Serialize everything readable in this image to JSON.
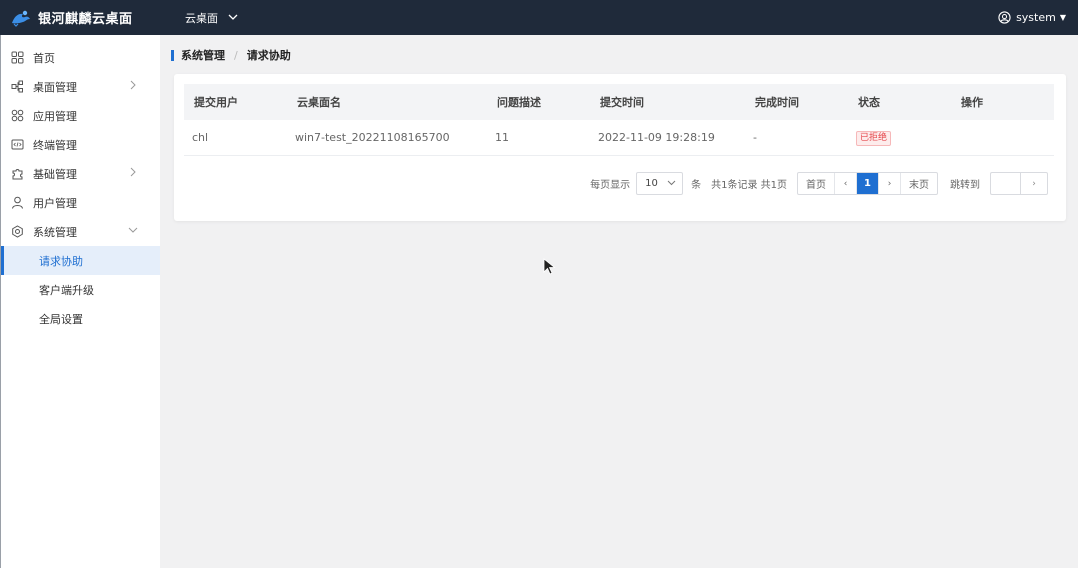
{
  "header": {
    "brand": "银河麒麟云桌面",
    "desk_switch": "云桌面",
    "user": "system"
  },
  "sidebar": {
    "items": [
      {
        "label": "首页",
        "icon": "grid-icon"
      },
      {
        "label": "桌面管理",
        "icon": "nodes-icon",
        "expandable": true
      },
      {
        "label": "应用管理",
        "icon": "apps-icon"
      },
      {
        "label": "终端管理",
        "icon": "terminal-icon"
      },
      {
        "label": "基础管理",
        "icon": "puzzle-icon",
        "expandable": true
      },
      {
        "label": "用户管理",
        "icon": "user-icon"
      },
      {
        "label": "系统管理",
        "icon": "settings-icon",
        "expanded": true
      }
    ],
    "sub_items": [
      {
        "label": "请求协助",
        "active": true
      },
      {
        "label": "客户端升级"
      },
      {
        "label": "全局设置"
      }
    ]
  },
  "breadcrumb": {
    "parent": "系统管理",
    "separator": "/",
    "current": "请求协助"
  },
  "table": {
    "columns": [
      "提交用户",
      "云桌面名",
      "问题描述",
      "提交时间",
      "完成时间",
      "状态",
      "操作"
    ],
    "rows": [
      {
        "user": "chl",
        "desktop": "win7-test_20221108165700",
        "description": "11",
        "submit_time": "2022-11-09 19:28:19",
        "finish_time": "-",
        "status": "已拒绝",
        "action": ""
      }
    ]
  },
  "pagination": {
    "per_page_label": "每页显示",
    "per_page_value": "10",
    "unit": "条",
    "total_text": "共1条记录 共1页",
    "first": "首页",
    "prev": "‹",
    "current_page": "1",
    "next": "›",
    "last": "末页",
    "jump_label": "跳转到",
    "jump_go": "›"
  },
  "colors": {
    "topbar": "#1f2a3a",
    "accent": "#1f6fd1",
    "danger": "#e5484d"
  }
}
